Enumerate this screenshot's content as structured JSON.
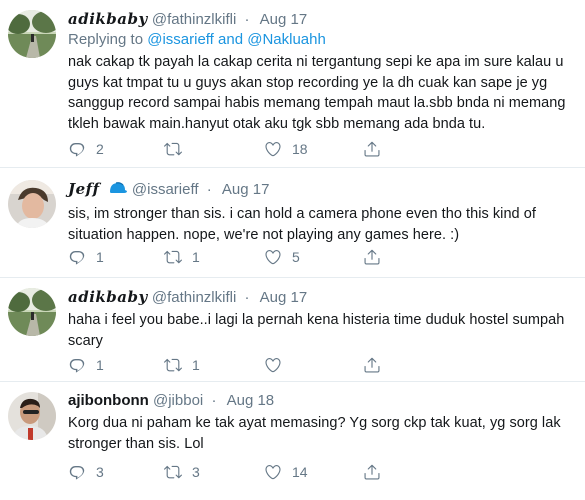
{
  "tweets": [
    {
      "name": "adikbaby",
      "handle": "@fathinzlkifli",
      "date": "Aug 17",
      "reply_prefix": "Replying to ",
      "reply_mention1": "@issarieff",
      "reply_and": " and ",
      "reply_mention2": "@Nakluahh",
      "text": "nak cakap tk payah la cakap cerita ni tergantung sepi ke apa im sure kalau u guys kat tmpat tu u guys akan stop recording ye la dh cuak kan sape je yg sanggup record sampai habis memang tempah maut la.sbb bnda ni memang tkleh bawak main.hanyut otak aku tgk sbb memang ada bnda tu.",
      "replies": "2",
      "retweets": "",
      "likes": "18"
    },
    {
      "name": "Jeff",
      "handle": "@issarieff",
      "date": "Aug 17",
      "text": "sis, im stronger than sis. i can hold a camera phone even tho this kind of situation happen. nope, we're not playing any games here. :)",
      "replies": "1",
      "retweets": "1",
      "likes": "5"
    },
    {
      "name": "adikbaby",
      "handle": "@fathinzlkifli",
      "date": "Aug 17",
      "text": "haha i feel you babe..i lagi la pernah kena histeria time duduk hostel sumpah scary",
      "replies": "1",
      "retweets": "1",
      "likes": ""
    },
    {
      "name": "ajibonbonn",
      "handle": "@jibboi",
      "date": "Aug 18",
      "text": "Korg dua ni paham ke tak ayat memasing? Yg sorg ckp tak kuat, yg sorg lak stronger than sis. Lol",
      "replies": "3",
      "retweets": "3",
      "likes": "14"
    }
  ],
  "separator": "·",
  "colors": {
    "icon": "#657786",
    "link": "#1b95e0",
    "badge": "#1b95e0",
    "divider": "#e6ecf0"
  },
  "icons": {
    "reply": "reply-icon",
    "retweet": "retweet-icon",
    "like": "heart-icon",
    "share": "share-icon"
  }
}
